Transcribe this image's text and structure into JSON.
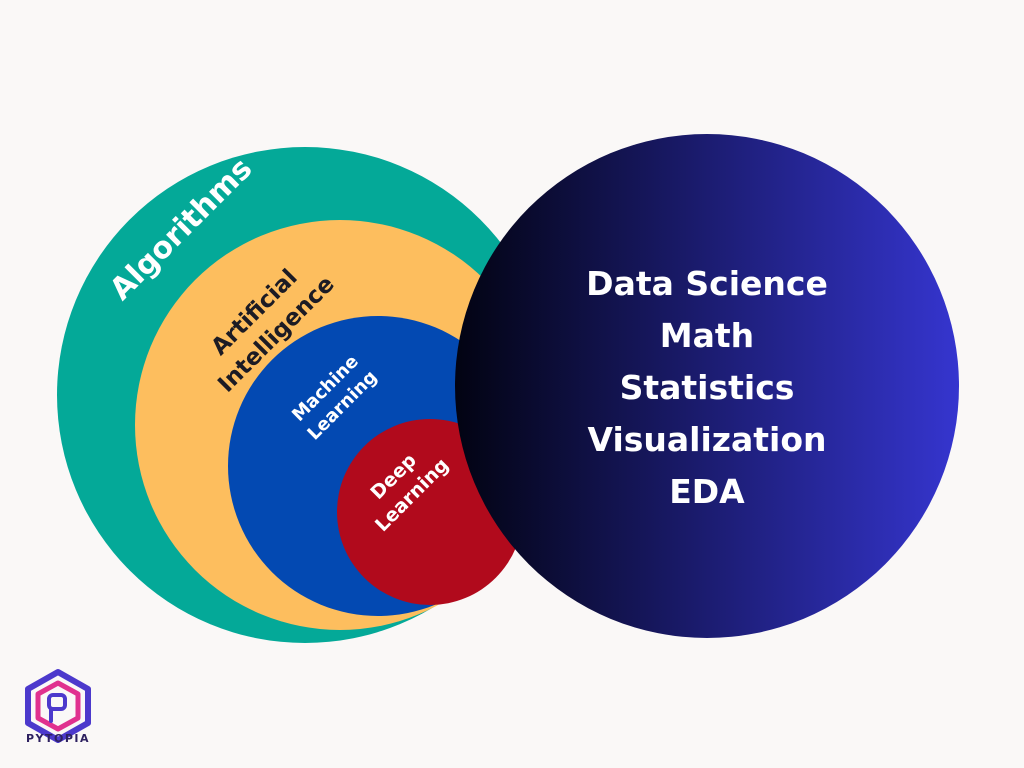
{
  "circles": {
    "algorithms": {
      "label": "Algorithms",
      "color": "#04a998"
    },
    "artificial_intelligence": {
      "line1": "Artificial",
      "line2": "Intelligence",
      "color": "#fdbe5e"
    },
    "machine_learning": {
      "line1": "Machine",
      "line2": "Learning",
      "color": "#0349b2"
    },
    "deep_learning": {
      "line1": "Deep",
      "line2": "Learning",
      "color": "#b10a1c"
    },
    "data_science": {
      "gradient_start": "#020312",
      "gradient_end": "#3535cf",
      "items": [
        "Data Science",
        "Math",
        "Statistics",
        "Visualization",
        "EDA"
      ]
    }
  },
  "logo": {
    "text": "PYTOPIA",
    "icon": "pytopia-hexagon-icon",
    "colors": [
      "#4c39cc",
      "#e0318f"
    ]
  },
  "text_colors": {
    "light": "#ffffff",
    "dark": "#1c1b24"
  }
}
